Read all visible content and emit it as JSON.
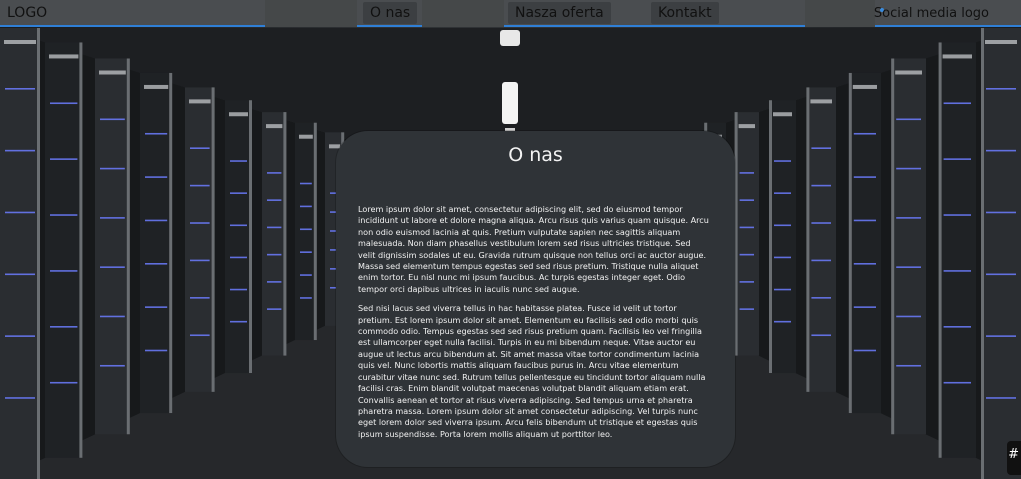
{
  "nav": {
    "logo": "LOGO",
    "links": [
      "O nas",
      "Nasza oferta",
      "Kontakt"
    ],
    "social": "Social media logo"
  },
  "card": {
    "title": "O nas",
    "paragraphs": [
      "Lorem ipsum dolor sit amet, consectetur adipiscing elit, sed do eiusmod tempor incididunt ut labore et dolore magna aliqua. Arcu risus quis varius quam quisque. Arcu non odio euismod lacinia at quis. Pretium vulputate sapien nec sagittis aliquam malesuada. Non diam phasellus vestibulum lorem sed risus ultricies tristique. Sed velit dignissim sodales ut eu. Gravida rutrum quisque non tellus orci ac auctor augue. Massa sed elementum tempus egestas sed sed risus pretium. Tristique nulla aliquet enim tortor. Eu nisl nunc mi ipsum faucibus. Ac turpis egestas integer eget. Odio tempor orci dapibus ultrices in iaculis nunc sed augue.",
      "Sed nisi lacus sed viverra tellus in hac habitasse platea. Fusce id velit ut tortor pretium. Est lorem ipsum dolor sit amet. Elementum eu facilisis sed odio morbi quis commodo odio. Tempus egestas sed sed risus pretium quam. Facilisis leo vel fringilla est ullamcorper eget nulla facilisi. Turpis in eu mi bibendum neque. Vitae auctor eu augue ut lectus arcu bibendum at. Sit amet massa vitae tortor condimentum lacinia quis vel. Nunc lobortis mattis aliquam faucibus purus in. Arcu vitae elementum curabitur vitae nunc sed. Rutrum tellus pellentesque eu tincidunt tortor aliquam nulla facilisi cras. Enim blandit volutpat maecenas volutpat blandit aliquam etiam erat. Convallis aenean et tortor at risus viverra adipiscing. Sed tempus urna et pharetra pharetra massa. Lorem ipsum dolor sit amet consectetur adipiscing. Vel turpis nunc eget lorem dolor sed viverra ipsum. Arcu felis bibendum ut tristique et egestas quis ipsum suspendisse. Porta lorem mollis aliquam ut porttitor leo."
    ]
  },
  "corner_badge": "#",
  "icons": {
    "accent_color": "#2f7fd6"
  }
}
